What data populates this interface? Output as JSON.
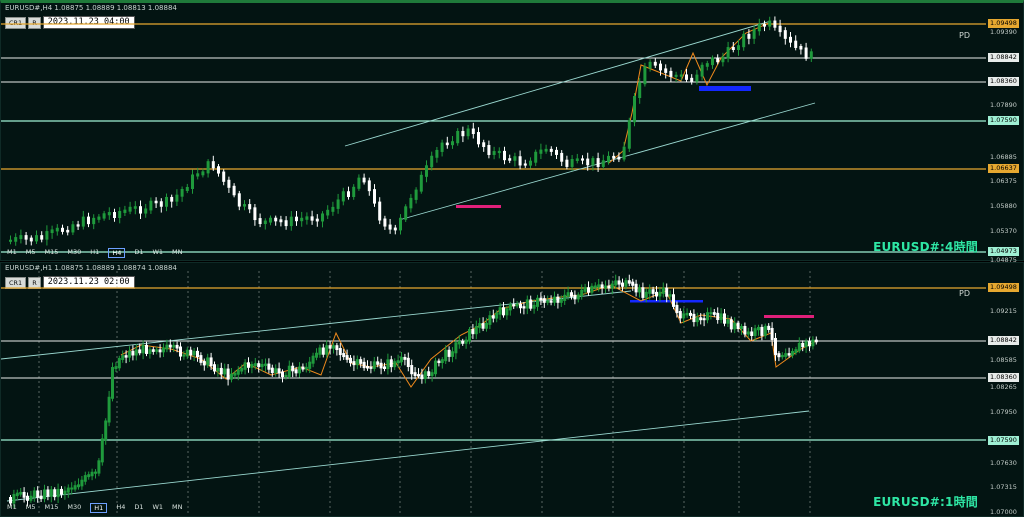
{
  "top": {
    "header": "EURUSD#,H4  1.08875 1.08889 1.08813 1.08884",
    "chips": [
      "CR1",
      "R"
    ],
    "date_box": "2023.11.23 04:00",
    "timeframes": [
      "M1",
      "M5",
      "M15",
      "M30",
      "H1",
      "H4",
      "D1",
      "W1",
      "MN"
    ],
    "selected_timeframe": "H4",
    "title": "EURUSD#:4時間",
    "pd_label": "PD",
    "ticks": [
      "1.09390",
      "1.07890",
      "1.06885",
      "1.06375",
      "1.05880",
      "1.05370",
      "1.04875"
    ],
    "labels": [
      {
        "text": "1.09498",
        "kind": "orange"
      },
      {
        "text": "1.08842",
        "kind": "white"
      },
      {
        "text": "1.08360",
        "kind": "white"
      },
      {
        "text": "1.07590",
        "kind": "mint"
      },
      {
        "text": "1.06637",
        "kind": "orange"
      },
      {
        "text": "1.04973",
        "kind": "mint"
      }
    ]
  },
  "bottom": {
    "header": "EURUSD#,H1  1.08875 1.08889 1.08874 1.08884",
    "chips": [
      "CR1",
      "R"
    ],
    "date_box": "2023.11.23 02:00",
    "timeframes": [
      "M1",
      "M5",
      "M15",
      "M30",
      "H1",
      "H4",
      "D1",
      "W1",
      "MN"
    ],
    "selected_timeframe": "H1",
    "title": "EURUSD#:1時間",
    "pd_label": "PD",
    "ticks": [
      "1.09215",
      "1.08585",
      "1.08265",
      "1.07950",
      "1.07630",
      "1.07315",
      "1.07000",
      "1.06680"
    ],
    "labels": [
      {
        "text": "1.09498",
        "kind": "orange"
      },
      {
        "text": "1.08842",
        "kind": "white"
      },
      {
        "text": "1.08360",
        "kind": "white"
      },
      {
        "text": "1.07590",
        "kind": "mint"
      }
    ]
  },
  "colors": {
    "orange": "#e6a830",
    "white": "#e8ecea",
    "mint": "#9ff0d4",
    "bull": "#1f9a3c",
    "bear": "#ffffff",
    "zigzag": "#f08a1c",
    "channel": "#9ad8d0",
    "blue_zone": "#1428ff",
    "pink_zone": "#e0207a"
  }
}
